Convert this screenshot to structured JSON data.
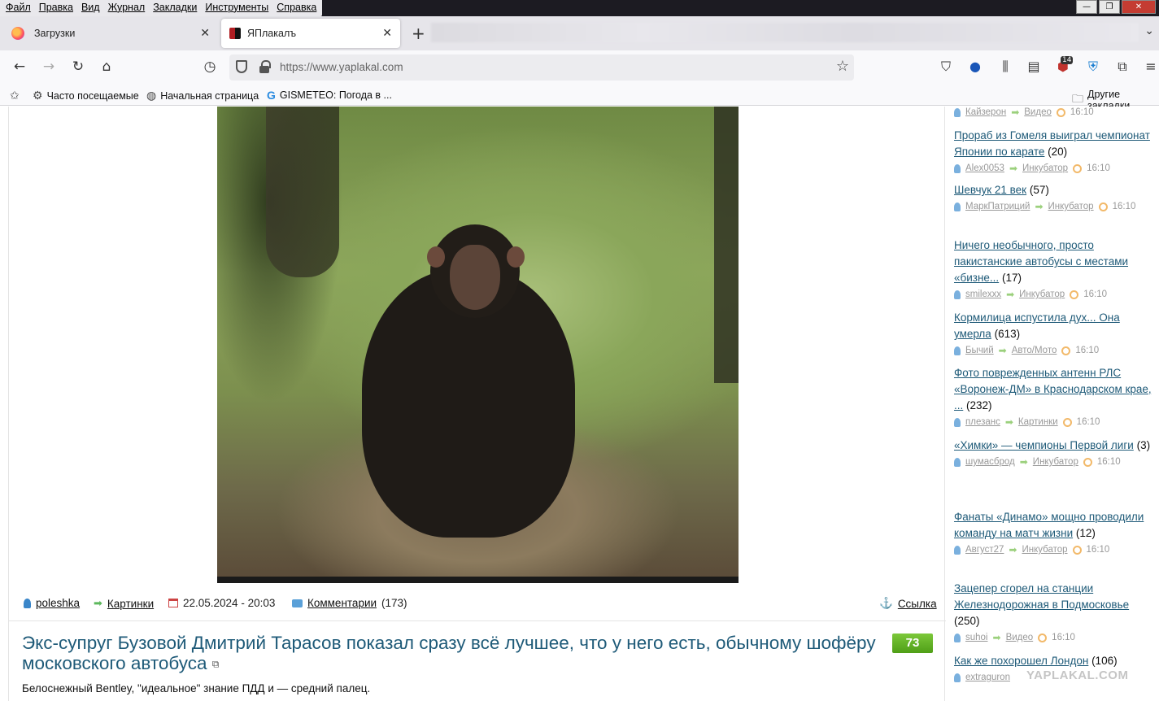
{
  "menu": [
    "Файл",
    "Правка",
    "Вид",
    "Журнал",
    "Закладки",
    "Инструменты",
    "Справка"
  ],
  "window_controls": {
    "minimize": "—",
    "restore": "❐",
    "close": "✕"
  },
  "tabs": [
    {
      "label": "Загрузки",
      "active": false
    },
    {
      "label": "ЯПлакалъ",
      "active": true
    }
  ],
  "url": "https://www.yaplakal.com",
  "extension_badge": "14",
  "bookmarks": [
    {
      "label": "Часто посещаемые",
      "icon": "gear-icon"
    },
    {
      "label": "Начальная страница",
      "icon": "globe-icon"
    },
    {
      "label": "GISMETEO: Погода в ...",
      "icon": "gismeteo-icon"
    }
  ],
  "other_bookmarks": "Другие закладки",
  "post": {
    "author": "poleshka",
    "section": "Картинки",
    "date": "22.05.2024 - 20:03",
    "comments_label": "Комментарии",
    "comments_count": "(173)",
    "link_label": "Ссылка"
  },
  "next_post": {
    "title": "Экс-супруг Бузовой Дмитрий Тарасов показал сразу всё лучшее, что у него есть, обычному шофёру московского автобуса",
    "rating": "73",
    "subtitle": "Белоснежный Bentley, \"идеальное\" знание ПДД и — средний палец."
  },
  "sidebar": [
    {
      "title": "",
      "count": "",
      "user": "Кайзерон",
      "section": "Видео",
      "time": "16:10"
    },
    {
      "title": "Прораб из Гомеля выиграл чемпионат Японии по карате",
      "count": "(20)",
      "user": "Alex0053",
      "section": "Инкубатор",
      "time": "16:10"
    },
    {
      "title": "Шевчук 21 век",
      "count": "(57)",
      "user": "МаркПатриций",
      "section": "Инкубатор",
      "time": "16:10"
    },
    {
      "title": "Ничего необычного, просто пакистанские автобусы с местами «бизне...",
      "count": "(17)",
      "user": "smilexxx",
      "section": "Инкубатор",
      "time": "16:10"
    },
    {
      "title": "Кормилица испустила дух... Она умерла",
      "count": "(613)",
      "user": "Бычий",
      "section": "Авто/Мото",
      "time": "16:10"
    },
    {
      "title": "Фото поврежденных антенн РЛС «Воронеж-ДМ» в Краснодарском крае, ...",
      "count": "(232)",
      "user": "плезанс",
      "section": "Картинки",
      "time": "16:10"
    },
    {
      "title": "«Химки» — чемпионы Первой лиги",
      "count": "(3)",
      "user": "шумасброд",
      "section": "Инкубатор",
      "time": "16:10"
    },
    {
      "title": "Фанаты «Динамо» мощно проводили команду на матч жизни",
      "count": "(12)",
      "user": "Август27",
      "section": "Инкубатор",
      "time": "16:10"
    },
    {
      "title": "Зацепер сгорел на станции Железнодорожная в Подмосковье",
      "count": "(250)",
      "user": "suhoi",
      "section": "Видео",
      "time": "16:10"
    },
    {
      "title": "Как же похорошел Лондон",
      "count": "(106)",
      "user": "extraguron",
      "section": "",
      "time": ""
    }
  ],
  "watermark": "YAPLAKAL.COM"
}
